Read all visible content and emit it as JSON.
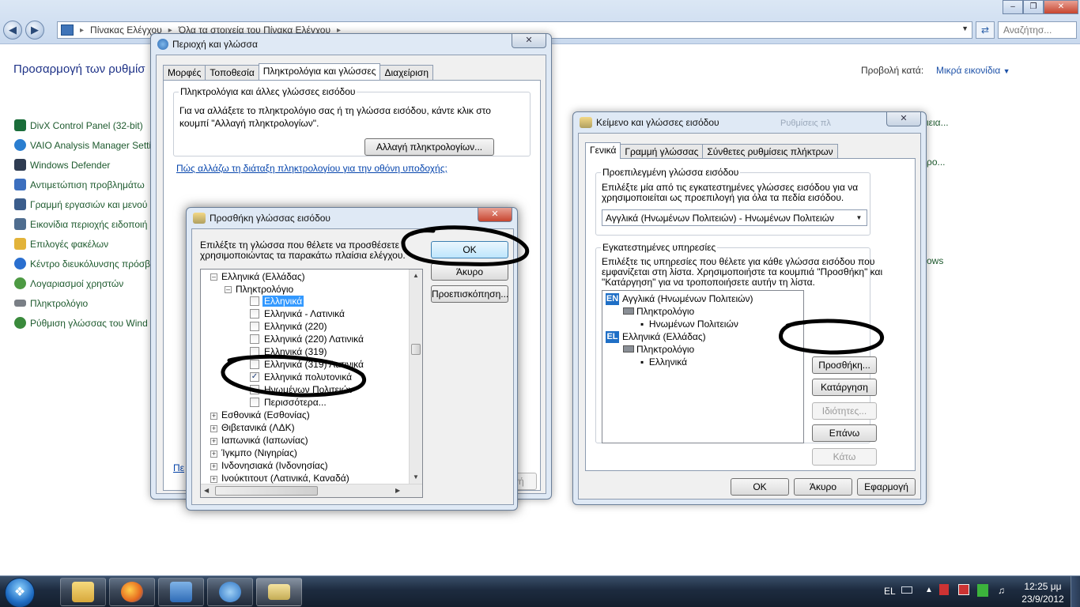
{
  "explorer": {
    "breadcrumb": [
      "Πίνακας Ελέγχου",
      "Όλα τα στοιχεία του Πίνακα Ελέγχου"
    ],
    "search_placeholder": "Αναζήτησ...",
    "title": "Προσαρμογή των ρυθμίσ",
    "view_by_label": "Προβολή κατά:",
    "view_by_value": "Μικρά εικονίδια",
    "items": [
      {
        "label": "DivX Control Panel (32-bit)",
        "color": "#1a6d3a"
      },
      {
        "label": "VAIO Analysis Manager Settin",
        "color": "#2a7ed0"
      },
      {
        "label": "Windows Defender",
        "color": "#2f3c52"
      },
      {
        "label": "Αντιμετώπιση προβλημάτω",
        "color": "#3c6fbf"
      },
      {
        "label": "Γραμμή εργασιών και μενού",
        "color": "#3b5d8c"
      },
      {
        "label": "Εικονίδια περιοχής ειδοποιή",
        "color": "#4f6d8f"
      },
      {
        "label": "Επιλογές φακέλων",
        "color": "#e2b33a"
      },
      {
        "label": "Κέντρο διευκόλυνσης πρόσβ",
        "color": "#2a6fcf"
      },
      {
        "label": "Λογαριασμοί χρηστών",
        "color": "#4d9a43"
      },
      {
        "label": "Πληκτρολόγιο",
        "color": "#7a7f86"
      },
      {
        "label": "Ρύθμιση γλώσσας του Wind",
        "color": "#3a8a3c"
      }
    ],
    "right_items": [
      "ιεια...",
      "ρο...",
      "ows"
    ],
    "hidden_link": "Πε"
  },
  "region": {
    "title": "Περιοχή και γλώσσα",
    "tabs": [
      "Μορφές",
      "Τοποθεσία",
      "Πληκτρολόγια και γλώσσες",
      "Διαχείριση"
    ],
    "group_label": "Πληκτρολόγια και άλλες γλώσσες εισόδου",
    "desc_line1": "Για να αλλάξετε το πληκτρολόγιο σας ή τη γλώσσα εισόδου, κάντε κλικ στο",
    "desc_line2": "κουμπί \"Αλλαγή πληκτρολογίων\".",
    "change_button": "Αλλαγή πληκτρολογίων...",
    "link": "Πώς αλλάζω τη διάταξη πληκτρολογίου για την οθόνη υποδοχής;",
    "apply_partial": "ογή"
  },
  "add_lang": {
    "title": "Προσθήκη γλώσσας εισόδου",
    "instruction_line1": "Επιλέξτε τη γλώσσα που θέλετε να προσθέσετε",
    "instruction_line2": "χρησιμοποιώντας τα παρακάτω πλαίσια ελέγχου.",
    "ok": "OK",
    "cancel": "Άκυρο",
    "preview": "Προεπισκόπηση...",
    "tree": {
      "root": "Ελληνικά (Ελλάδας)",
      "keyboard": "Πληκτρολόγιο",
      "layouts": [
        {
          "label": "Ελληνικά",
          "checked": false,
          "selected": true
        },
        {
          "label": "Ελληνικά - Λατινικά",
          "checked": false
        },
        {
          "label": "Ελληνικά (220)",
          "checked": false
        },
        {
          "label": "Ελληνικά (220) Λατινικά",
          "checked": false
        },
        {
          "label": "Ελληνικά (319)",
          "checked": false
        },
        {
          "label": "Ελληνικά (319) Λατινικά",
          "checked": false
        },
        {
          "label": "Ελληνικά πολυτονικά",
          "checked": true
        },
        {
          "label": "Ηνωμένων Πολιτειών",
          "checked": false
        },
        {
          "label": "Περισσότερα...",
          "checked": false
        }
      ],
      "languages": [
        "Εσθονικά (Εσθονίας)",
        "Θιβετανικά (ΛΔΚ)",
        "Ιαπωνικά (Ιαπωνίας)",
        "Ίγκμπο (Νιγηρίας)",
        "Ινδονησιακά (Ινδονησίας)",
        "Ινούκτιτουτ (Λατινικά, Καναδά)"
      ]
    }
  },
  "text_services": {
    "title": "Κείμενο και γλώσσες εισόδου",
    "tabs": [
      "Γενικά",
      "Γραμμή γλώσσας",
      "Σύνθετες ρυθμίσεις πλήκτρων"
    ],
    "default_group": "Προεπιλεγμένη γλώσσα εισόδου",
    "default_desc_line1": "Επιλέξτε μία από τις εγκατεστημένες γλώσσες εισόδου για να",
    "default_desc_line2": "χρησιμοποιείται ως προεπιλογή για όλα τα πεδία εισόδου.",
    "default_value": "Αγγλικά (Ηνωμένων Πολιτειών) - Ηνωμένων Πολιτειών",
    "installed_group": "Εγκατεστημένες υπηρεσίες",
    "installed_desc_line1": "Επιλέξτε τις υπηρεσίες που θέλετε για κάθε γλώσσα εισόδου που",
    "installed_desc_line2": "εμφανίζεται στη λίστα. Χρησιμοποιήστε τα κουμπιά \"Προσθήκη\" και",
    "installed_desc_line3": "\"Κατάργηση\" για να τροποποιήσετε αυτήν τη λίστα.",
    "services": [
      {
        "badge": "EN",
        "lang": "Αγγλικά (Ηνωμένων Πολιτειών)",
        "keyboard": "Πληκτρολόγιο",
        "layout": "Ηνωμένων Πολιτειών"
      },
      {
        "badge": "EL",
        "lang": "Ελληνικά (Ελλάδας)",
        "keyboard": "Πληκτρολόγιο",
        "layout": "Ελληνικά"
      }
    ],
    "add": "Προσθήκη...",
    "remove": "Κατάργηση",
    "properties": "Ιδιότητες...",
    "up": "Επάνω",
    "down": "Κάτω",
    "ok": "OK",
    "cancel": "Άκυρο",
    "apply": "Εφαρμογή",
    "behind_text": "Ρυθμίσεις πλ"
  },
  "taskbar": {
    "lang": "EL",
    "time": "12:25 μμ",
    "date": "23/9/2012"
  }
}
